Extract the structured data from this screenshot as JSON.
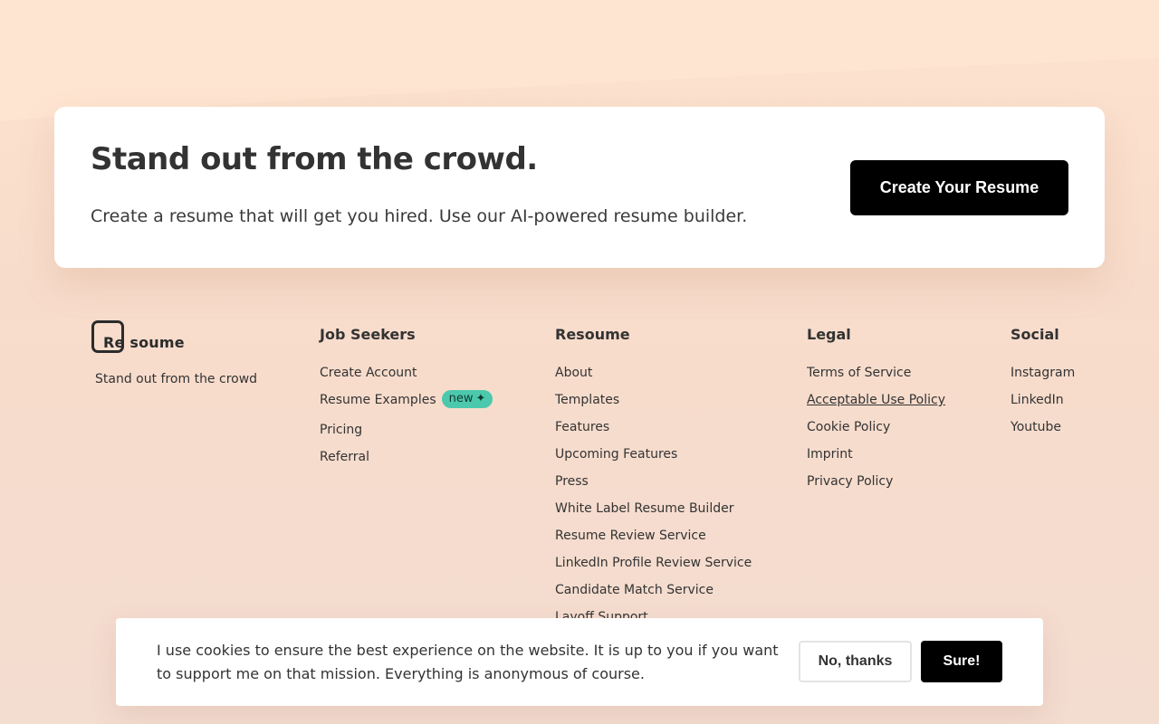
{
  "cta": {
    "title": "Stand out from the crowd.",
    "subtitle": "Create a resume that will get you hired. Use our AI-powered resume builder.",
    "button_label": "Create Your Resume"
  },
  "brand": {
    "logo_prefix": "Re",
    "logo_suffix": "soume",
    "tagline": "Stand out from the crowd"
  },
  "footer": {
    "job_seekers": {
      "heading": "Job Seekers",
      "links": [
        "Create Account",
        "Resume Examples",
        "Pricing",
        "Referral"
      ],
      "badge": "new",
      "badge_icon": "sparkle-icon"
    },
    "resoume": {
      "heading": "Resoume",
      "links": [
        "About",
        "Templates",
        "Features",
        "Upcoming Features",
        "Press",
        "White Label Resume Builder",
        "Resume Review Service",
        "LinkedIn Profile Review Service",
        "Candidate Match Service",
        "Layoff Support"
      ]
    },
    "legal": {
      "heading": "Legal",
      "links": [
        "Terms of Service",
        "Acceptable Use Policy",
        "Cookie Policy",
        "Imprint",
        "Privacy Policy"
      ]
    },
    "social": {
      "heading": "Social",
      "links": [
        "Instagram",
        "LinkedIn",
        "Youtube"
      ]
    }
  },
  "cookie": {
    "message": "I use cookies to ensure the best experience on the website. It is up to you if you want to support me on that mission. Everything is anonymous of course.",
    "decline_label": "No, thanks",
    "accept_label": "Sure!"
  },
  "colors": {
    "badge_bg": "#4cc9ad",
    "primary_button": "#000000",
    "background": "#f8dccb"
  }
}
